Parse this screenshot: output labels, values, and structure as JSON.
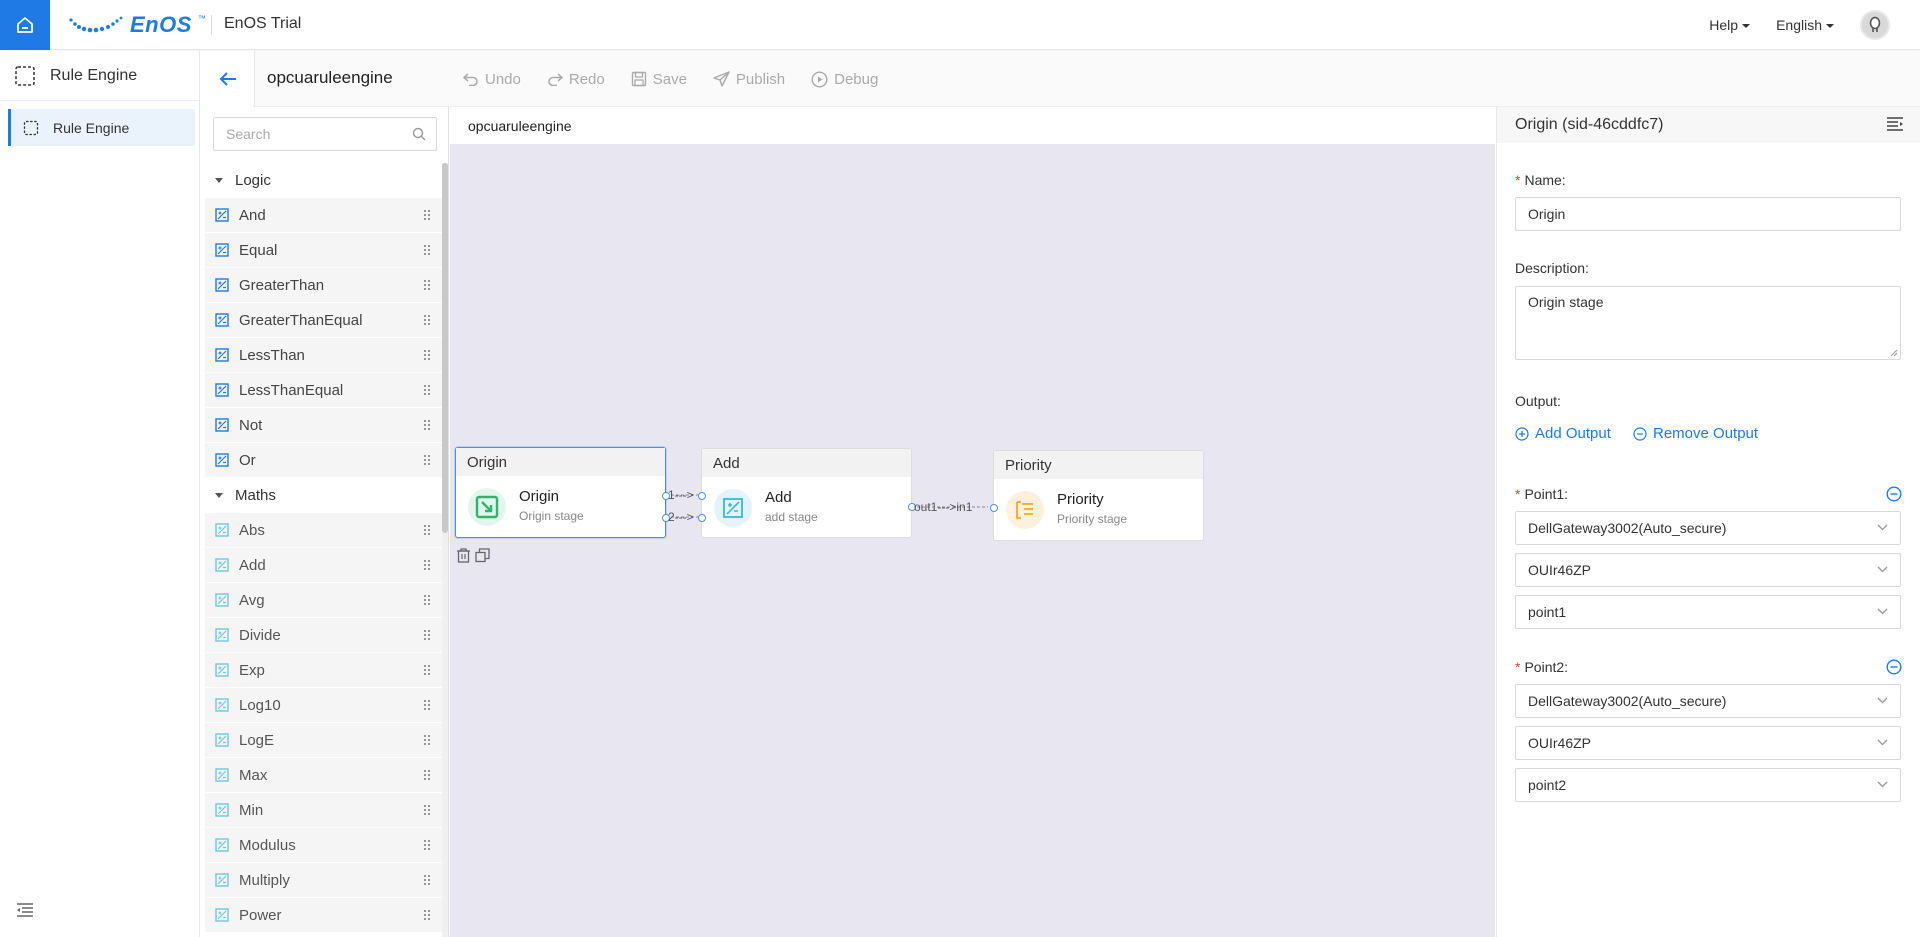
{
  "header": {
    "logo_text": "EnOS",
    "logo_tm": "™",
    "app_title": "EnOS Trial",
    "help_label": "Help",
    "language_label": "English"
  },
  "leftnav": {
    "title": "Rule Engine",
    "items": [
      {
        "label": "Rule Engine",
        "active": true
      }
    ]
  },
  "toolbar": {
    "flow_name": "opcuaruleengine",
    "undo": "Undo",
    "redo": "Redo",
    "save": "Save",
    "publish": "Publish",
    "debug": "Debug"
  },
  "palette": {
    "search_placeholder": "Search",
    "groups": [
      {
        "name": "Logic",
        "items": [
          "And",
          "Equal",
          "GreaterThan",
          "GreaterThanEqual",
          "LessThan",
          "LessThanEqual",
          "Not",
          "Or"
        ]
      },
      {
        "name": "Maths",
        "items": [
          "Abs",
          "Add",
          "Avg",
          "Divide",
          "Exp",
          "Log10",
          "LogE",
          "Max",
          "Min",
          "Modulus",
          "Multiply",
          "Power"
        ]
      }
    ]
  },
  "canvas": {
    "tab_label": "opcuaruleengine",
    "nodes": [
      {
        "title": "Origin",
        "name": "Origin",
        "sub": "Origin stage",
        "selected": true,
        "icon": "origin-icon",
        "color": "#2fb36f"
      },
      {
        "title": "Add",
        "name": "Add",
        "sub": "add stage",
        "icon": "add-stage-icon",
        "color": "#3ab8d8"
      },
      {
        "title": "Priority",
        "name": "Priority",
        "sub": "Priority stage",
        "icon": "priority-icon",
        "color": "#f5a623"
      }
    ],
    "links": [
      {
        "label": "1--->"
      },
      {
        "label": "2--->"
      },
      {
        "label": "out1--->in1"
      }
    ]
  },
  "props": {
    "title": "Origin (sid-46cddfc7)",
    "name_label": "Name:",
    "name_value": "Origin",
    "description_label": "Description:",
    "description_value": "Origin stage",
    "output_label": "Output:",
    "add_output": "Add Output",
    "remove_output": "Remove Output",
    "point1": {
      "label": "Point1:",
      "device": "DellGateway3002(Auto_secure)",
      "model": "OUIr46ZP",
      "point": "point1"
    },
    "point2": {
      "label": "Point2:",
      "device": "DellGateway3002(Auto_secure)",
      "model": "OUIr46ZP",
      "point": "point2"
    }
  },
  "colors": {
    "accent": "#1f7ae6",
    "canvas_bg": "#e8e6f1",
    "required": "#e53935"
  }
}
